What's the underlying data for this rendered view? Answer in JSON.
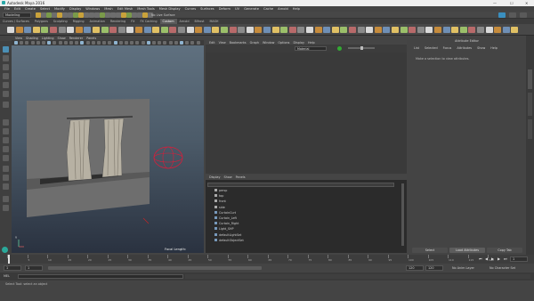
{
  "window": {
    "title": "Autodesk Maya 2016",
    "minimize": "—",
    "maximize": "☐",
    "close": "✕"
  },
  "menubar": [
    "File",
    "Edit",
    "Create",
    "Select",
    "Modify",
    "Display",
    "Windows",
    "Mesh",
    "Edit Mesh",
    "Mesh Tools",
    "Mesh Display",
    "Curves",
    "Surfaces",
    "Deform",
    "UV",
    "Generate",
    "Cache",
    "Arnold",
    "Help"
  ],
  "status": {
    "menuset": "Modeling",
    "live_label": "No Live Surface"
  },
  "shelf_tabs": [
    "Curves / Surfaces",
    "Polygons",
    "Sculpting",
    "Rigging",
    "Animation",
    "Rendering",
    "FX",
    "FX Caching",
    "Custom",
    "Arnold",
    "Bifrost",
    "MASH"
  ],
  "shelf_active": "Custom",
  "viewport": {
    "menu": [
      "View",
      "Shading",
      "Lighting",
      "Show",
      "Renderer",
      "Panels"
    ],
    "camera_label": "Focal Length:",
    "axis_label": "Y"
  },
  "node_editor": {
    "menu": [
      "Edit",
      "View",
      "Bookmarks",
      "Graph",
      "Window",
      "Options",
      "Display",
      "Help"
    ],
    "field_value": "Material"
  },
  "outliner": {
    "menu": [
      "Display",
      "Show",
      "Panels"
    ],
    "items": [
      "persp",
      "top",
      "front",
      "side",
      "CurtainCurt",
      "Curtain_Left",
      "Curtain_Right",
      "Light_SHP",
      "defaultLightSet",
      "defaultObjectSet"
    ]
  },
  "attribute_editor": {
    "title": "Attribute Editor",
    "tabs": [
      "List",
      "Selected",
      "Focus",
      "Attributes",
      "Show",
      "Help"
    ],
    "message": "Make a selection to view attributes.",
    "button_load": "Load Attributes",
    "button_left": "Select",
    "button_right": "Copy Tab"
  },
  "timeline": {
    "ticks": [
      "1",
      "5",
      "10",
      "15",
      "20",
      "25",
      "30",
      "35",
      "40",
      "45",
      "50",
      "55",
      "60",
      "65",
      "70",
      "75",
      "80",
      "85",
      "90",
      "95",
      "100",
      "105",
      "110",
      "115",
      "120"
    ],
    "current_frame": "1"
  },
  "range": {
    "start": "1",
    "inner_start": "1",
    "inner_end": "120",
    "end": "120",
    "max": "200",
    "anim_layer": "No Anim Layer",
    "char_set": "No Character Set"
  },
  "command_line": {
    "label": "MEL"
  },
  "help_line": {
    "text": "Select Tool: select an object"
  }
}
